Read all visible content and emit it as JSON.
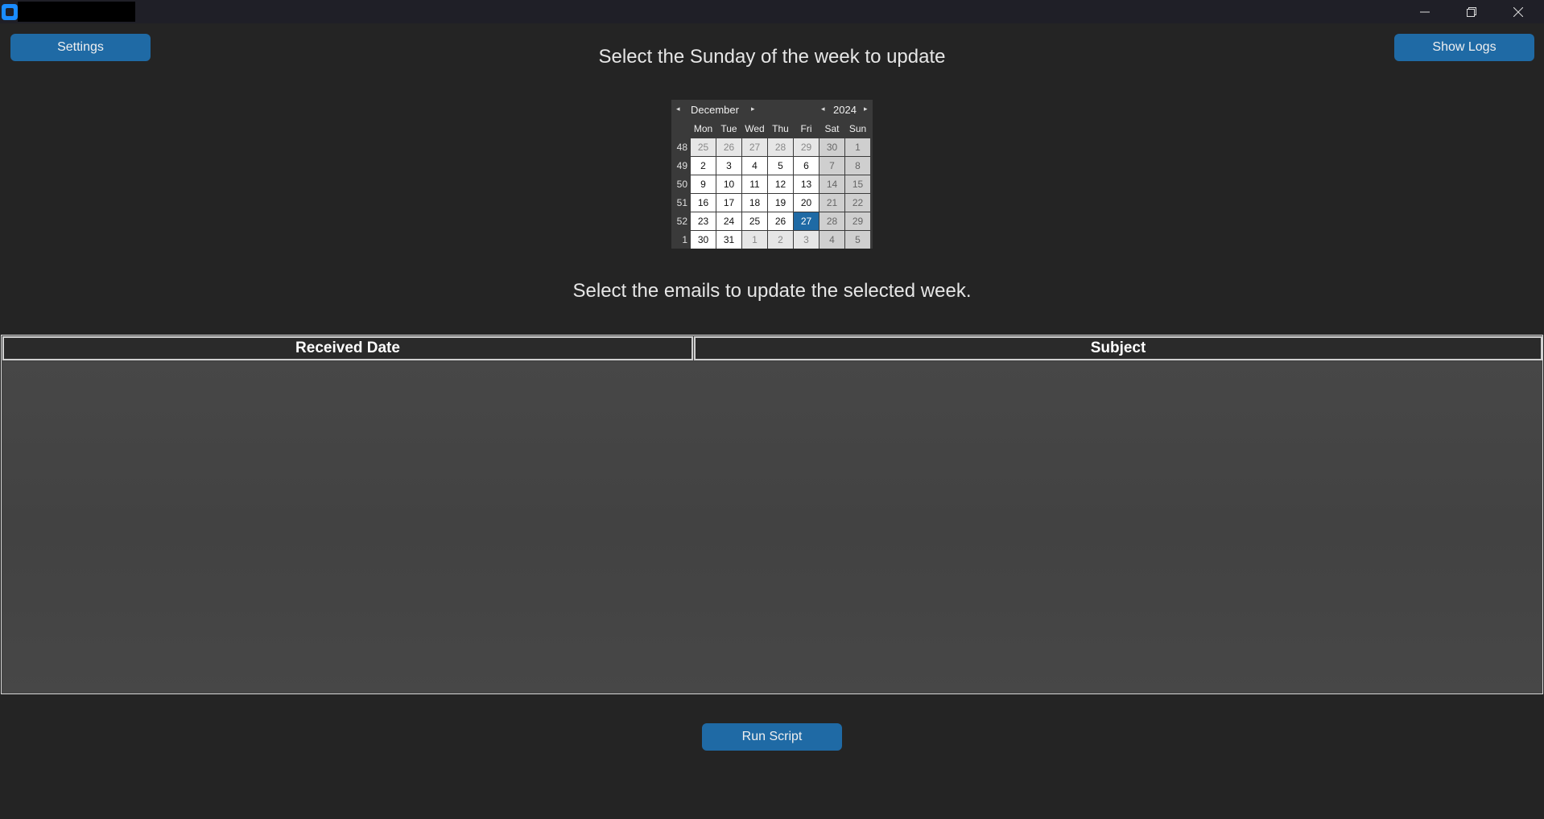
{
  "window": {
    "minimize_icon": "minimize-icon",
    "maximize_icon": "restore-icon",
    "close_icon": "close-icon"
  },
  "buttons": {
    "settings": "Settings",
    "show_logs": "Show Logs",
    "run_script": "Run Script"
  },
  "headings": {
    "select_sunday": "Select the Sunday of the week to update",
    "select_emails": "Select the emails to update the selected week."
  },
  "calendar": {
    "month": "December",
    "year": "2024",
    "weekdays": [
      "Mon",
      "Tue",
      "Wed",
      "Thu",
      "Fri",
      "Sat",
      "Sun"
    ],
    "selected": "27",
    "weeks": [
      {
        "num": "48",
        "days": [
          "25",
          "26",
          "27",
          "28",
          "29",
          "30",
          "1"
        ]
      },
      {
        "num": "49",
        "days": [
          "2",
          "3",
          "4",
          "5",
          "6",
          "7",
          "8"
        ]
      },
      {
        "num": "50",
        "days": [
          "9",
          "10",
          "11",
          "12",
          "13",
          "14",
          "15"
        ]
      },
      {
        "num": "51",
        "days": [
          "16",
          "17",
          "18",
          "19",
          "20",
          "21",
          "22"
        ]
      },
      {
        "num": "52",
        "days": [
          "23",
          "24",
          "25",
          "26",
          "27",
          "28",
          "29"
        ]
      },
      {
        "num": "1",
        "days": [
          "30",
          "31",
          "1",
          "2",
          "3",
          "4",
          "5"
        ]
      }
    ]
  },
  "table": {
    "columns": [
      "Received Date",
      "Subject"
    ],
    "rows": []
  },
  "colors": {
    "background": "#242424",
    "accent": "#1f6aa5",
    "titlebar": "#1f1f27"
  }
}
